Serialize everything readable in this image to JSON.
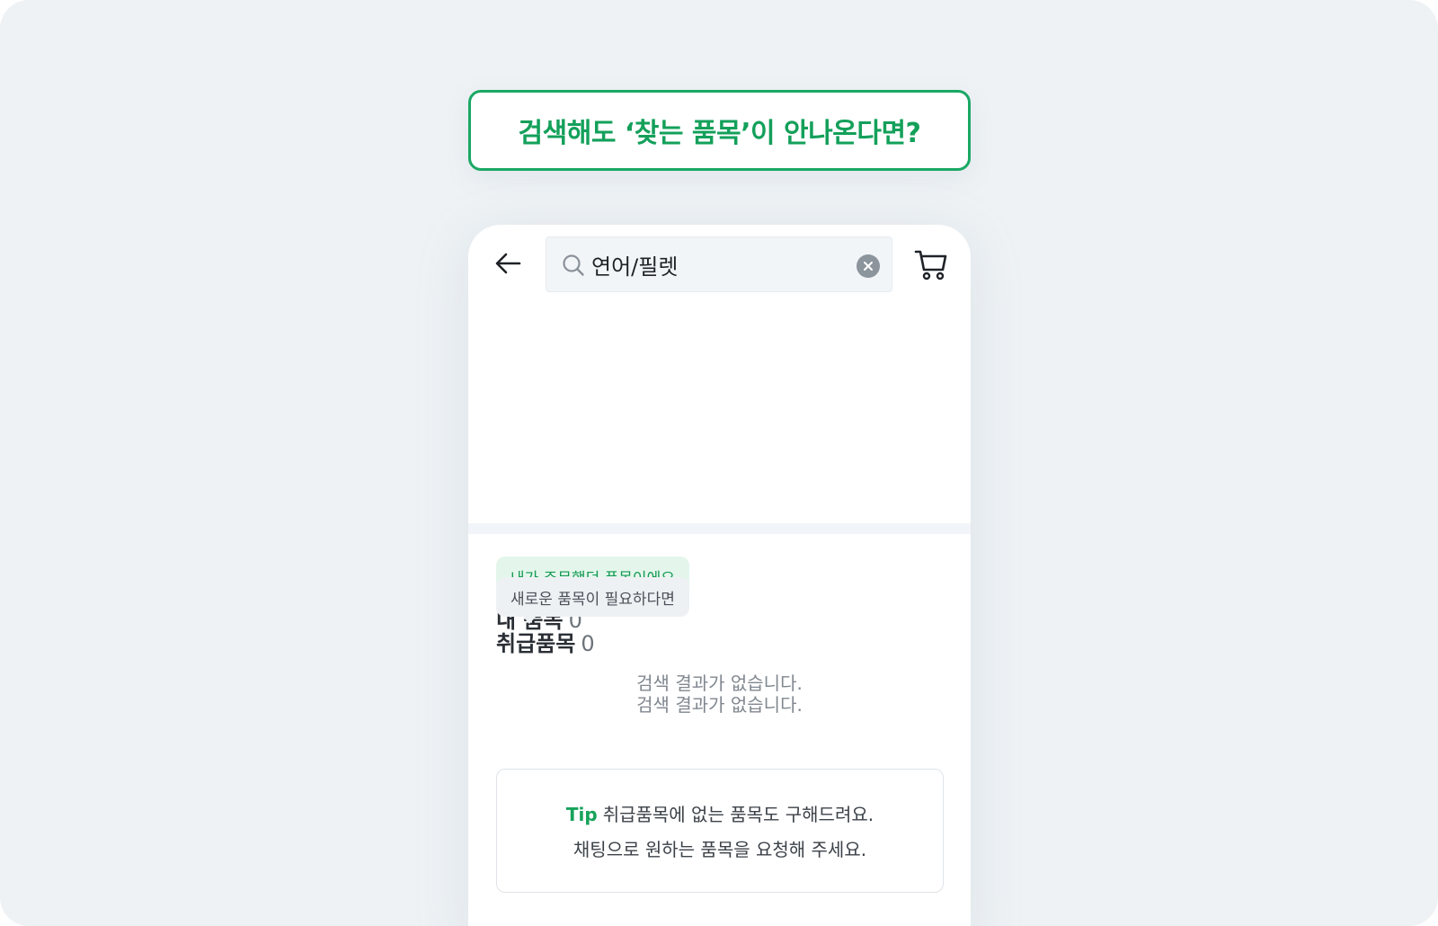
{
  "headline": "검색해도 ‘찾는 품목’이 안나온다면?",
  "search": {
    "query": "연어/필렛",
    "icon": "search-icon",
    "clear_icon": "clear-icon"
  },
  "toolbar": {
    "back_icon": "arrow-left-icon",
    "cart_icon": "cart-icon"
  },
  "my_items": {
    "bubble": "내가 주문했던 품목이에요",
    "title": "내 품목",
    "count": "0",
    "empty": "검색 결과가 없습니다."
  },
  "handled_items": {
    "bubble": "새로운 품목이 필요하다면",
    "title": "취급품목",
    "count": "0",
    "empty": "검색 결과가 없습니다."
  },
  "tip": {
    "label": "Tip",
    "line1": "취급품목에 없는 품목도 구해드려요.",
    "line2": "채팅으로 원하는 품목을 요청해 주세요."
  },
  "colors": {
    "accent": "#13a05a",
    "background": "#eef2f5",
    "bubble_green": "#e4f6ec",
    "bubble_gray": "#eef1f4"
  }
}
